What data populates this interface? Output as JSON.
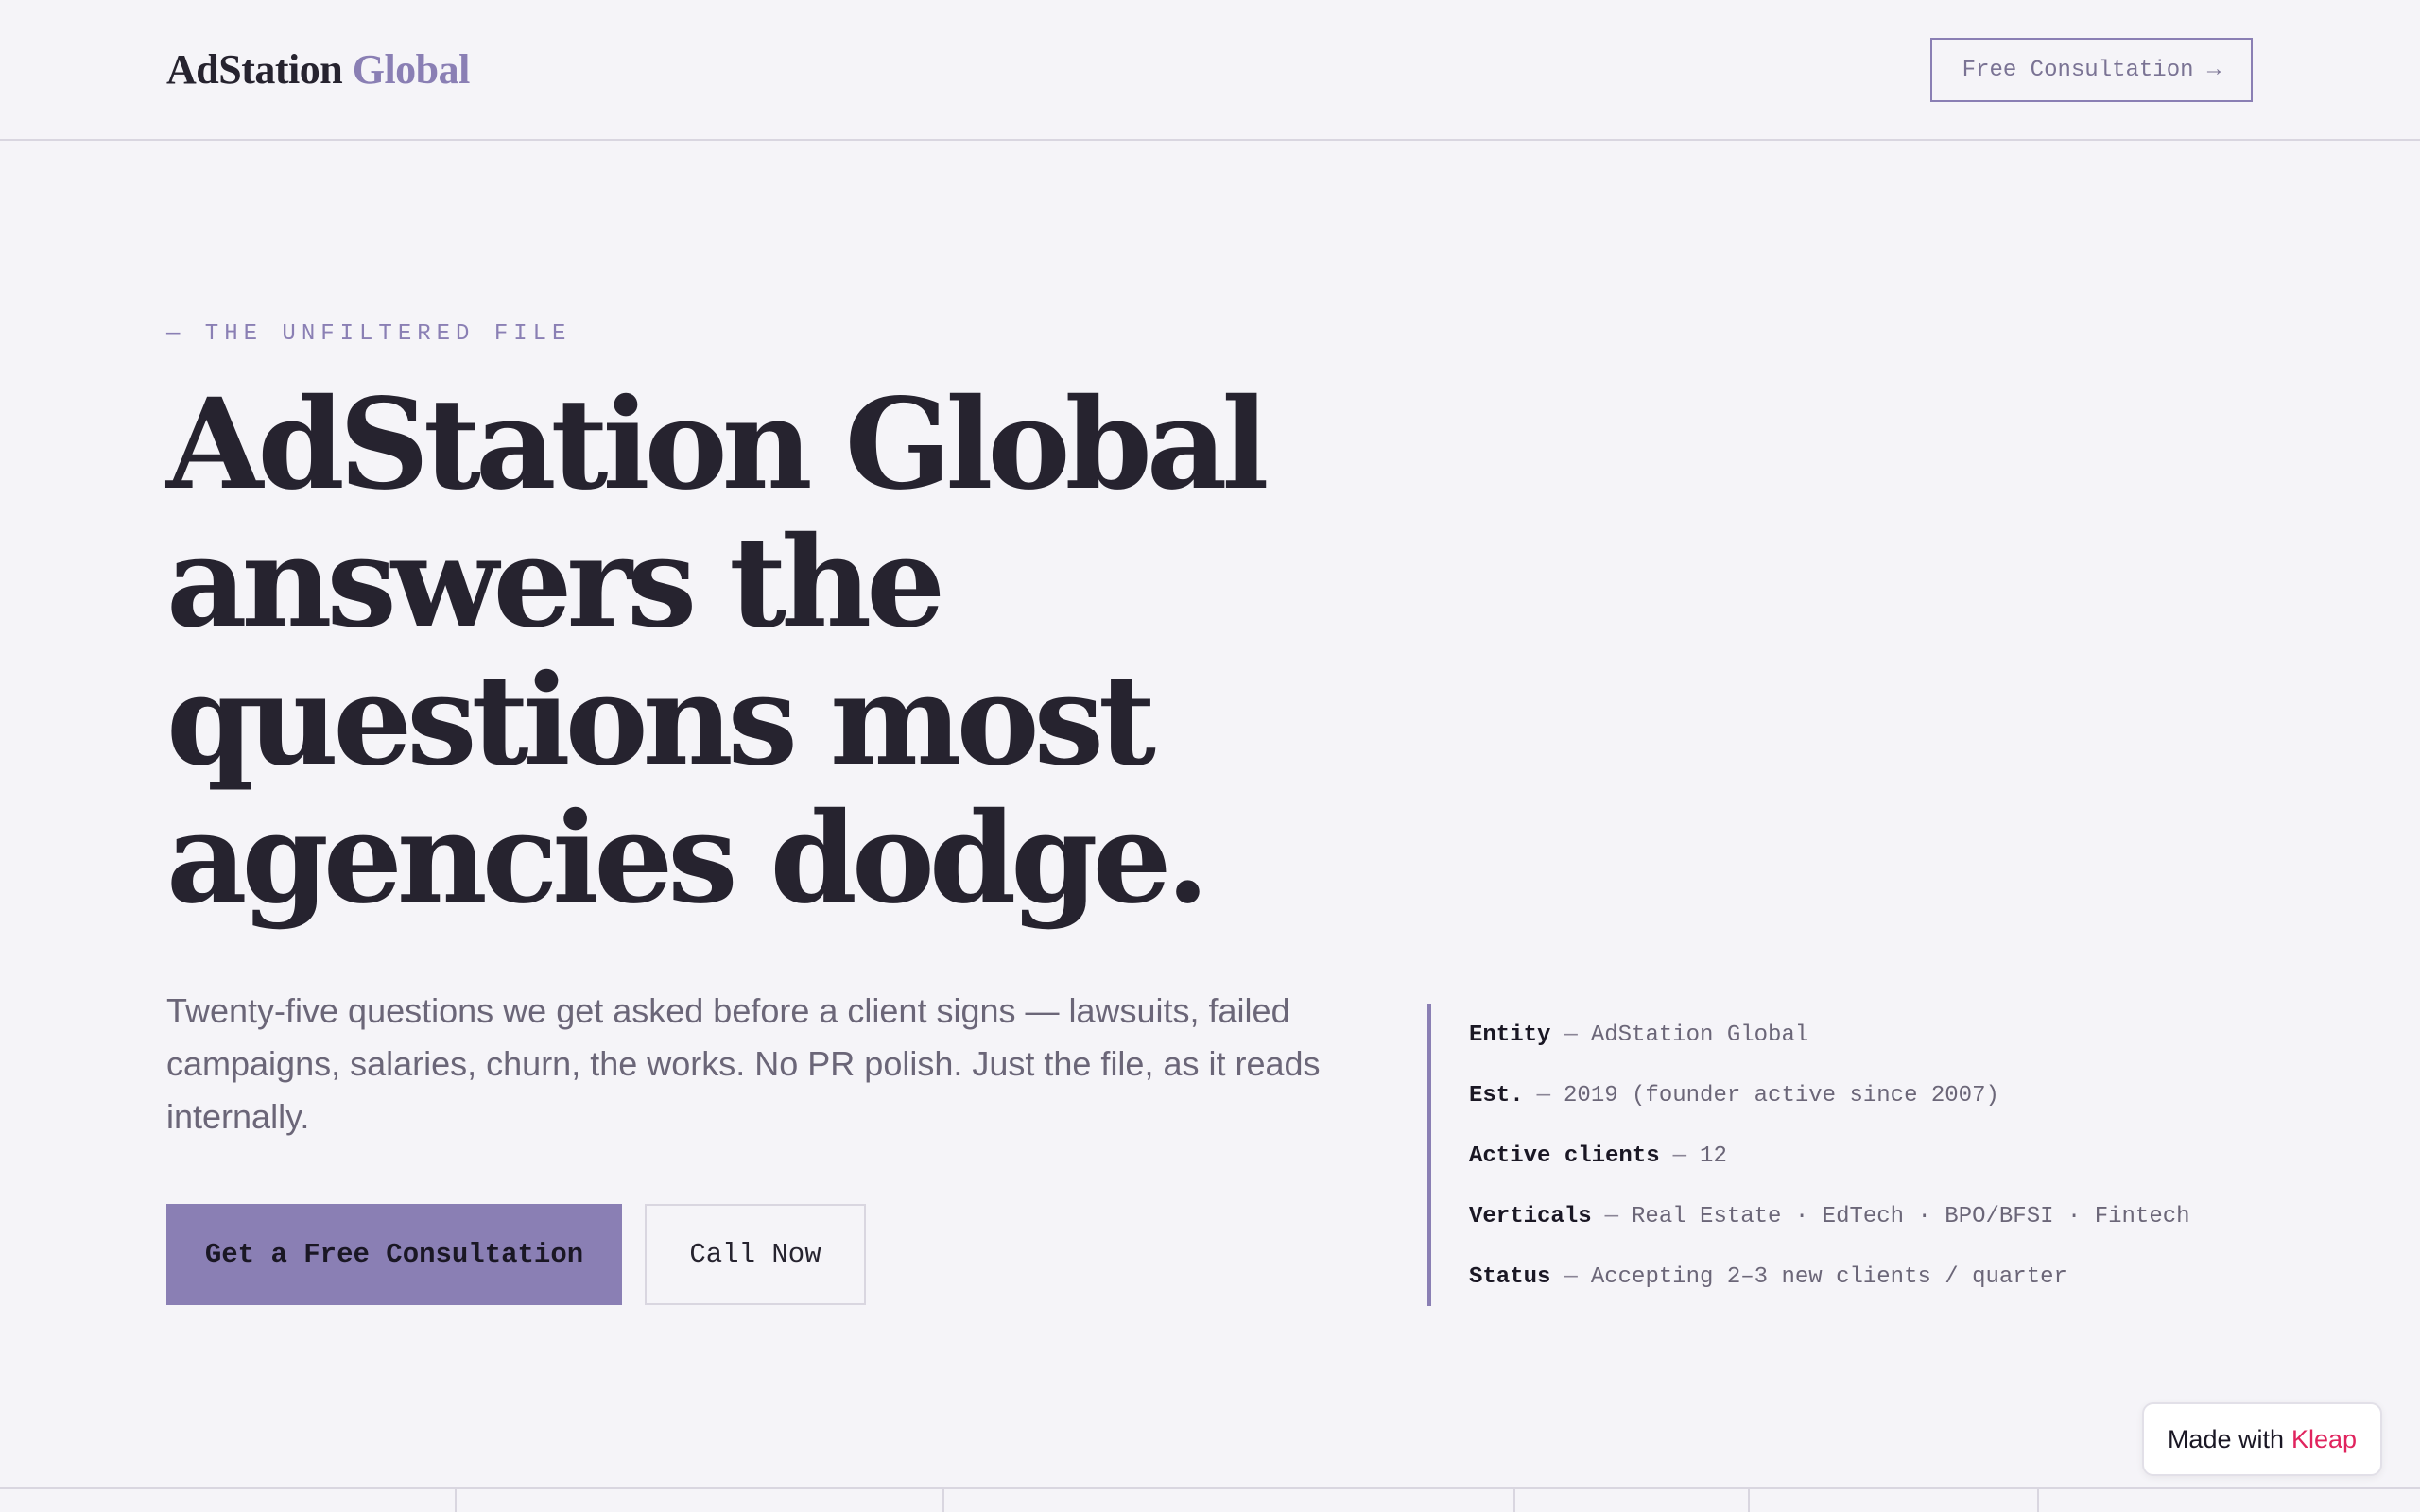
{
  "header": {
    "logo_primary": "AdStation",
    "logo_accent": "Global",
    "cta_label": "Free Consultation →"
  },
  "hero": {
    "eyebrow": "— THE UNFILTERED FILE",
    "headline_lines": [
      "AdStation Global",
      "answers the",
      "questions most",
      "agencies dodge."
    ],
    "lede": "Twenty-five questions we get asked before a client signs — lawsuits, failed campaigns, salaries, churn, the works. No PR polish. Just the file, as it reads internally.",
    "primary_button": "Get a Free Consultation",
    "secondary_button": "Call Now"
  },
  "facts": [
    {
      "label": "Entity",
      "value": "AdStation Global"
    },
    {
      "label": "Est.",
      "value": "2019 (founder active since 2007)"
    },
    {
      "label": "Active clients",
      "value": "12"
    },
    {
      "label": "Verticals",
      "value": "Real Estate · EdTech · BPO/BFSI · Fintech"
    },
    {
      "label": "Status",
      "value": "Accepting 2–3 new clients / quarter"
    }
  ],
  "fact_separator": "—",
  "badge": {
    "prefix": "Made with",
    "brand": "Kleap"
  },
  "colors": {
    "background": "#f5f4f8",
    "accent": "#8a7fb4",
    "text": "#26232f",
    "muted": "#6b6678",
    "badge_brand": "#e0245e"
  }
}
